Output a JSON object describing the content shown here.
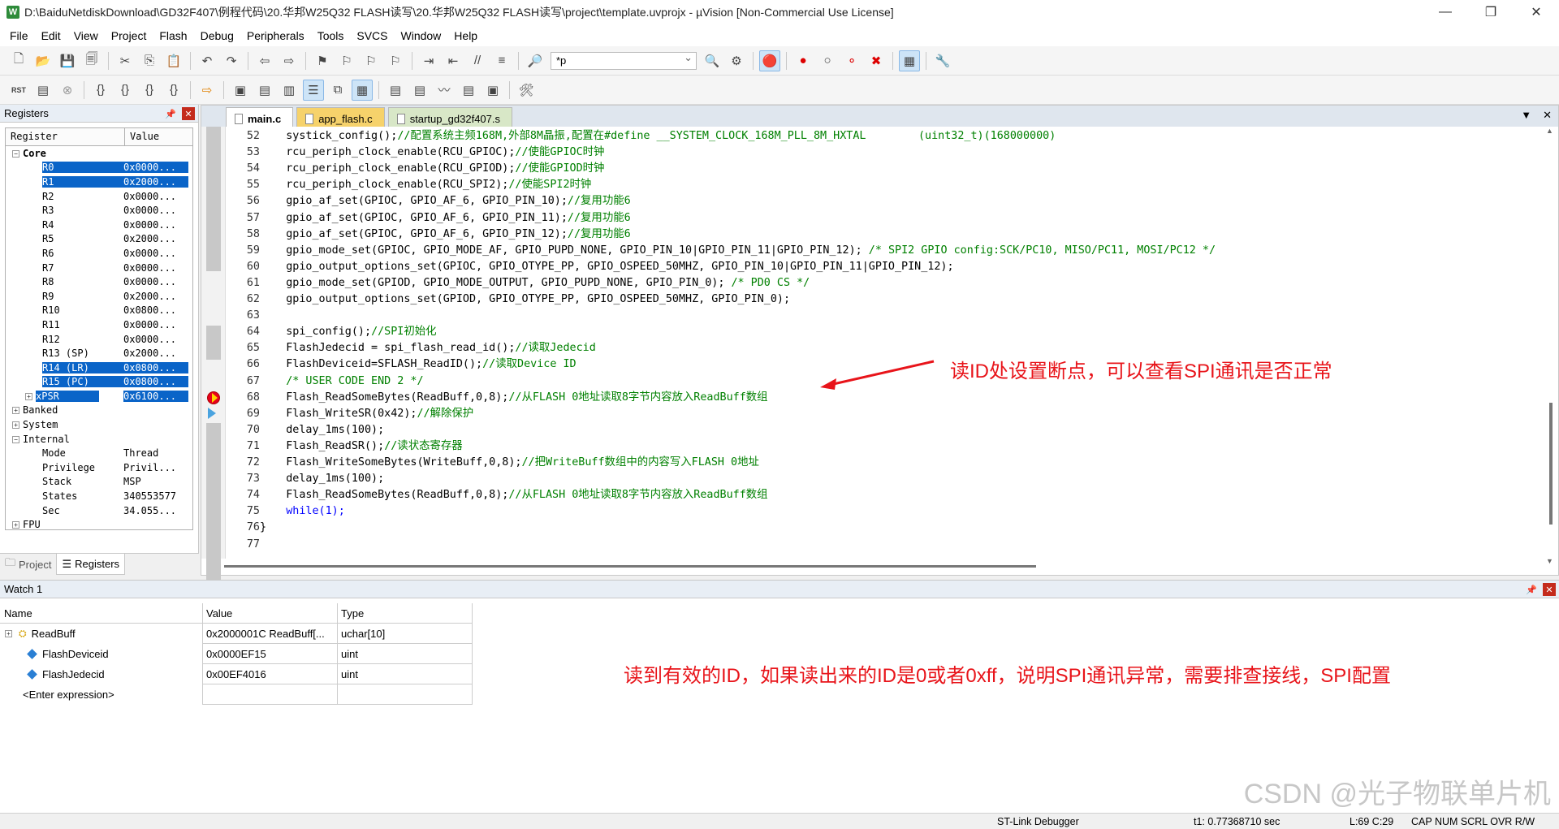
{
  "window": {
    "title": "D:\\BaiduNetdiskDownload\\GD32F407\\例程代码\\20.华邦W25Q32 FLASH读写\\20.华邦W25Q32 FLASH读写\\project\\template.uvprojx - µVision  [Non-Commercial Use License]",
    "app_icon": "W",
    "minimize": "—",
    "restore": "❐",
    "close": "✕"
  },
  "menu": [
    "File",
    "Edit",
    "View",
    "Project",
    "Flash",
    "Debug",
    "Peripherals",
    "Tools",
    "SVCS",
    "Window",
    "Help"
  ],
  "toolbar": {
    "find_value": "*p"
  },
  "registers_panel": {
    "title": "Registers",
    "col_register": "Register",
    "col_value": "Value",
    "rows": [
      {
        "name": "Core",
        "value": "",
        "level": 0,
        "expander": "−",
        "bold": true
      },
      {
        "name": "R0",
        "value": "0x0000...",
        "level": 2,
        "selected": true
      },
      {
        "name": "R1",
        "value": "0x2000...",
        "level": 2,
        "selected": true
      },
      {
        "name": "R2",
        "value": "0x0000...",
        "level": 2
      },
      {
        "name": "R3",
        "value": "0x0000...",
        "level": 2
      },
      {
        "name": "R4",
        "value": "0x0000...",
        "level": 2
      },
      {
        "name": "R5",
        "value": "0x2000...",
        "level": 2
      },
      {
        "name": "R6",
        "value": "0x0000...",
        "level": 2
      },
      {
        "name": "R7",
        "value": "0x0000...",
        "level": 2
      },
      {
        "name": "R8",
        "value": "0x0000...",
        "level": 2
      },
      {
        "name": "R9",
        "value": "0x2000...",
        "level": 2
      },
      {
        "name": "R10",
        "value": "0x0800...",
        "level": 2
      },
      {
        "name": "R11",
        "value": "0x0000...",
        "level": 2
      },
      {
        "name": "R12",
        "value": "0x0000...",
        "level": 2
      },
      {
        "name": "R13 (SP)",
        "value": "0x2000...",
        "level": 2
      },
      {
        "name": "R14 (LR)",
        "value": "0x0800...",
        "level": 2,
        "selected": true
      },
      {
        "name": "R15 (PC)",
        "value": "0x0800...",
        "level": 2,
        "selected": true
      },
      {
        "name": "xPSR",
        "value": "0x6100...",
        "level": 1,
        "expander": "+",
        "selected": true
      },
      {
        "name": "Banked",
        "value": "",
        "level": 0,
        "expander": "+"
      },
      {
        "name": "System",
        "value": "",
        "level": 0,
        "expander": "+"
      },
      {
        "name": "Internal",
        "value": "",
        "level": 0,
        "expander": "−"
      },
      {
        "name": "Mode",
        "value": "Thread",
        "level": 2
      },
      {
        "name": "Privilege",
        "value": "Privil...",
        "level": 2
      },
      {
        "name": "Stack",
        "value": "MSP",
        "level": 2
      },
      {
        "name": "States",
        "value": "340553577",
        "level": 2
      },
      {
        "name": "Sec",
        "value": "34.055...",
        "level": 2
      },
      {
        "name": "FPU",
        "value": "",
        "level": 0,
        "expander": "+"
      }
    ],
    "tab_project": "Project",
    "tab_registers": "Registers"
  },
  "editor": {
    "tabs": [
      "main.c",
      "app_flash.c",
      "startup_gd32f407.s"
    ],
    "lines": [
      {
        "n": "52",
        "code": "    systick_config();",
        "comment": "//配置系统主频168M,外部8M晶振,配置在#define __SYSTEM_CLOCK_168M_PLL_8M_HXTAL        (uint32_t)(168000000)"
      },
      {
        "n": "53",
        "code": "    rcu_periph_clock_enable(RCU_GPIOC);",
        "comment": "//使能GPIOC时钟"
      },
      {
        "n": "54",
        "code": "    rcu_periph_clock_enable(RCU_GPIOD);",
        "comment": "//使能GPIOD时钟"
      },
      {
        "n": "55",
        "code": "    rcu_periph_clock_enable(RCU_SPI2);",
        "comment": "//使能SPI2时钟"
      },
      {
        "n": "56",
        "code": "    gpio_af_set(GPIOC, GPIO_AF_6, GPIO_PIN_10);",
        "comment": "//复用功能6"
      },
      {
        "n": "57",
        "code": "    gpio_af_set(GPIOC, GPIO_AF_6, GPIO_PIN_11);",
        "comment": "//复用功能6"
      },
      {
        "n": "58",
        "code": "    gpio_af_set(GPIOC, GPIO_AF_6, GPIO_PIN_12);",
        "comment": "//复用功能6"
      },
      {
        "n": "59",
        "code": "    gpio_mode_set(GPIOC, GPIO_MODE_AF, GPIO_PUPD_NONE, GPIO_PIN_10|GPIO_PIN_11|GPIO_PIN_12); ",
        "comment": "/* SPI2 GPIO config:SCK/PC10, MISO/PC11, MOSI/PC12 */"
      },
      {
        "n": "60",
        "code": "    gpio_output_options_set(GPIOC, GPIO_OTYPE_PP, GPIO_OSPEED_50MHZ, GPIO_PIN_10|GPIO_PIN_11|GPIO_PIN_12);",
        "comment": ""
      },
      {
        "n": "61",
        "code": "    gpio_mode_set(GPIOD, GPIO_MODE_OUTPUT, GPIO_PUPD_NONE, GPIO_PIN_0); ",
        "comment": "/* PD0 CS */"
      },
      {
        "n": "62",
        "code": "    gpio_output_options_set(GPIOD, GPIO_OTYPE_PP, GPIO_OSPEED_50MHZ, GPIO_PIN_0);",
        "comment": ""
      },
      {
        "n": "63",
        "code": "",
        "comment": ""
      },
      {
        "n": "64",
        "code": "    spi_config();",
        "comment": "//SPI初始化"
      },
      {
        "n": "65",
        "code": "    FlashJedecid = spi_flash_read_id();",
        "comment": "//读取Jedecid"
      },
      {
        "n": "66",
        "code": "    FlashDeviceid=SFLASH_ReadID();",
        "comment": "//读取Device ID"
      },
      {
        "n": "67",
        "code": "    ",
        "comment": "/* USER CODE END 2 */"
      },
      {
        "n": "68",
        "code": "    Flash_ReadSomeBytes(ReadBuff,0,8);",
        "comment": "//从FLASH 0地址读取8字节内容放入ReadBuff数组"
      },
      {
        "n": "69",
        "code": "    Flash_WriteSR(0x42);",
        "comment": "//解除保护"
      },
      {
        "n": "70",
        "code": "    delay_1ms(100);",
        "comment": ""
      },
      {
        "n": "71",
        "code": "    Flash_ReadSR();",
        "comment": "//读状态寄存器"
      },
      {
        "n": "72",
        "code": "    Flash_WriteSomeBytes(WriteBuff,0,8);",
        "comment": "//把WriteBuff数组中的内容写入FLASH 0地址"
      },
      {
        "n": "73",
        "code": "    delay_1ms(100);",
        "comment": ""
      },
      {
        "n": "74",
        "code": "    Flash_ReadSomeBytes(ReadBuff,0,8);",
        "comment": "//从FLASH 0地址读取8字节内容放入ReadBuff数组"
      },
      {
        "n": "75",
        "code": "    while(1);",
        "comment": ""
      },
      {
        "n": "76",
        "code": "}",
        "comment": ""
      },
      {
        "n": "77",
        "code": "",
        "comment": ""
      }
    ],
    "annotation": "读ID处设置断点，可以查看SPI通讯是否正常"
  },
  "watch": {
    "title": "Watch 1",
    "col_name": "Name",
    "col_value": "Value",
    "col_type": "Type",
    "rows": [
      {
        "name": "ReadBuff",
        "value": "0x2000001C ReadBuff[...",
        "type": "uchar[10]"
      },
      {
        "name": "FlashDeviceid",
        "value": "0x0000EF15",
        "type": "uint"
      },
      {
        "name": "FlashJedecid",
        "value": "0x00EF4016",
        "type": "uint"
      },
      {
        "name": "<Enter expression>",
        "value": "",
        "type": ""
      }
    ],
    "annotation": "读到有效的ID，如果读出来的ID是0或者0xff，说明SPI通讯异常，需要排查接线，SPI配置"
  },
  "status": {
    "debugger": "ST-Link Debugger",
    "time": "t1: 0.77368710 sec",
    "position": "L:69 C:29",
    "flags": "CAP  NUM  SCRL  OVR  R/W"
  },
  "watermark": "CSDN @光子物联单片机",
  "colors": {
    "annotation": "#e8141a",
    "selection": "#0a64c8",
    "comment": "#008000"
  }
}
